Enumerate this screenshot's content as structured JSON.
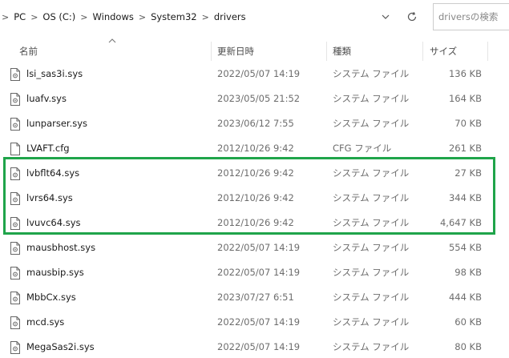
{
  "breadcrumb": {
    "items": [
      "PC",
      "OS (C:)",
      "Windows",
      "System32",
      "drivers"
    ]
  },
  "search": {
    "placeholder": "driversの検索"
  },
  "columns": {
    "name": "名前",
    "date": "更新日時",
    "type": "種類",
    "size": "サイズ"
  },
  "files": [
    {
      "name": "lsi_sas3i.sys",
      "date": "2022/05/07 14:19",
      "type": "システム ファイル",
      "size": "136 KB",
      "icon": "sys-file-icon"
    },
    {
      "name": "luafv.sys",
      "date": "2023/05/05 21:52",
      "type": "システム ファイル",
      "size": "164 KB",
      "icon": "sys-file-icon"
    },
    {
      "name": "lunparser.sys",
      "date": "2023/06/12 7:55",
      "type": "システム ファイル",
      "size": "70 KB",
      "icon": "sys-file-icon"
    },
    {
      "name": "LVAFT.cfg",
      "date": "2012/10/26 9:42",
      "type": "CFG ファイル",
      "size": "261 KB",
      "icon": "blank-file-icon"
    },
    {
      "name": "lvbflt64.sys",
      "date": "2012/10/26 9:42",
      "type": "システム ファイル",
      "size": "27 KB",
      "icon": "sys-file-icon"
    },
    {
      "name": "lvrs64.sys",
      "date": "2012/10/26 9:42",
      "type": "システム ファイル",
      "size": "344 KB",
      "icon": "sys-file-icon"
    },
    {
      "name": "lvuvc64.sys",
      "date": "2012/10/26 9:42",
      "type": "システム ファイル",
      "size": "4,647 KB",
      "icon": "sys-file-icon"
    },
    {
      "name": "mausbhost.sys",
      "date": "2022/05/07 14:19",
      "type": "システム ファイル",
      "size": "554 KB",
      "icon": "sys-file-icon"
    },
    {
      "name": "mausbip.sys",
      "date": "2022/05/07 14:19",
      "type": "システム ファイル",
      "size": "98 KB",
      "icon": "sys-file-icon"
    },
    {
      "name": "MbbCx.sys",
      "date": "2023/07/27 6:51",
      "type": "システム ファイル",
      "size": "444 KB",
      "icon": "sys-file-icon"
    },
    {
      "name": "mcd.sys",
      "date": "2022/05/07 14:19",
      "type": "システム ファイル",
      "size": "60 KB",
      "icon": "sys-file-icon"
    },
    {
      "name": "MegaSas2i.sys",
      "date": "2022/05/07 14:19",
      "type": "システム ファイル",
      "size": "80 KB",
      "icon": "sys-file-icon"
    }
  ],
  "highlight": {
    "color": "#1fa44a",
    "files": [
      "lvbflt64.sys",
      "lvrs64.sys",
      "lvuvc64.sys"
    ]
  }
}
